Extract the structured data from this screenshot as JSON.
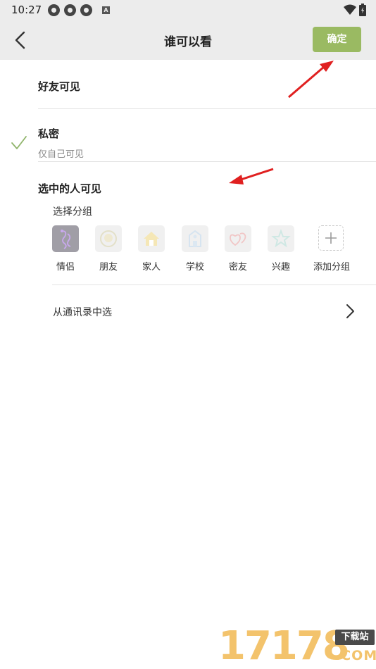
{
  "status_bar": {
    "time": "10:27",
    "left_icons": [
      "ring-icon",
      "ring-icon",
      "ring-icon",
      "a-badge-icon"
    ],
    "right_icons": [
      "wifi-icon",
      "battery-icon"
    ],
    "badge_letter": "A"
  },
  "header": {
    "back_icon": "chevron-left-icon",
    "title": "谁可以看",
    "confirm_label": "确定",
    "confirm_color": "#9aba62"
  },
  "options": [
    {
      "label": "好友可见",
      "selected": false
    },
    {
      "label": "私密",
      "sublabel": "仅自己可见",
      "selected": true
    },
    {
      "label": "选中的人可见",
      "selected": false
    }
  ],
  "selected_check_color": "#8fb46a",
  "groups_section": {
    "label": "选择分组",
    "groups": [
      {
        "name": "情侣",
        "icon": "couple-icon",
        "selected": true
      },
      {
        "name": "朋友",
        "icon": "friends-icon",
        "selected": false
      },
      {
        "name": "家人",
        "icon": "house-icon",
        "selected": false
      },
      {
        "name": "学校",
        "icon": "school-icon",
        "selected": false
      },
      {
        "name": "密友",
        "icon": "hearts-icon",
        "selected": false
      },
      {
        "name": "兴趣",
        "icon": "star-icon",
        "selected": false
      },
      {
        "name": "添加分组",
        "icon": "plus-icon",
        "selected": false
      }
    ]
  },
  "contacts_row": {
    "label": "从通讯录中选",
    "icon": "chevron-right-icon"
  },
  "watermark": {
    "number": "17178",
    "badge": "下载站",
    "domain": ".COM"
  }
}
